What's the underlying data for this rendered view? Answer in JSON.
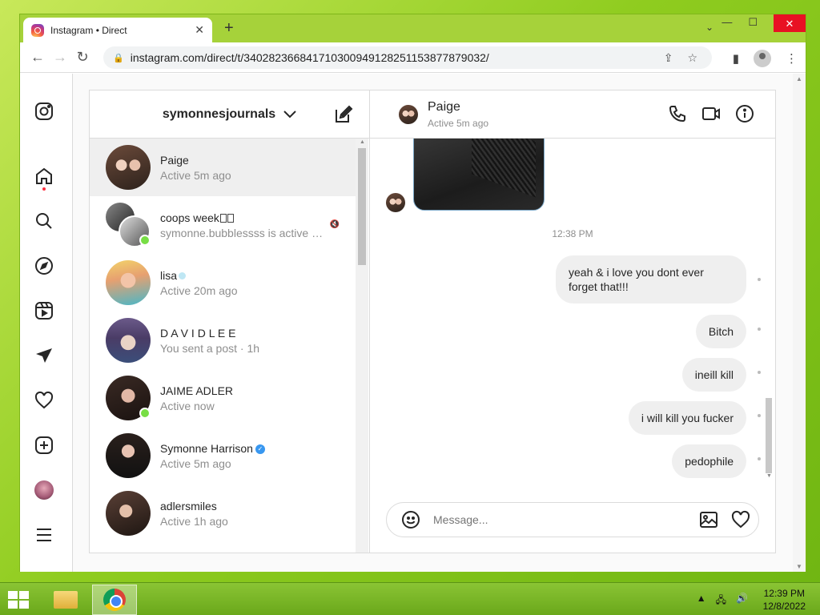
{
  "browser": {
    "tab_title": "Instagram • Direct",
    "url": "instagram.com/direct/t/340282366841710300949128251153877879032/"
  },
  "inbox": {
    "account_name": "symonnesjournals",
    "threads": [
      {
        "name": "Paige",
        "sub": "Active 5m ago",
        "active": true
      },
      {
        "name": "coops week",
        "sub": "symonne.bubblessss is active n...",
        "online": true
      },
      {
        "name": "lisa",
        "sub": "Active 20m ago"
      },
      {
        "name": "D A V I D L E E",
        "sub": "You sent a post · 1h"
      },
      {
        "name": "JAIME ADLER",
        "sub": "Active now",
        "online": true
      },
      {
        "name": "Symonne Harrison",
        "sub": "Active 5m ago",
        "verified": true
      },
      {
        "name": "adlersmiles",
        "sub": "Active 1h ago"
      }
    ]
  },
  "chat": {
    "name": "Paige",
    "status": "Active 5m ago",
    "timestamp": "12:38 PM",
    "messages": [
      "yeah & i love you dont ever forget that!!!",
      "Bitch",
      "ineill kill",
      "i will kill you fucker",
      "pedophile"
    ],
    "composer_placeholder": "Message..."
  },
  "taskbar": {
    "time": "12:39 PM",
    "date": "12/8/2022"
  },
  "colors": {
    "desktop_green": "#9dd32a",
    "online_green": "#78de45",
    "verified_blue": "#3897f0",
    "bubble_gray": "#efefef"
  }
}
